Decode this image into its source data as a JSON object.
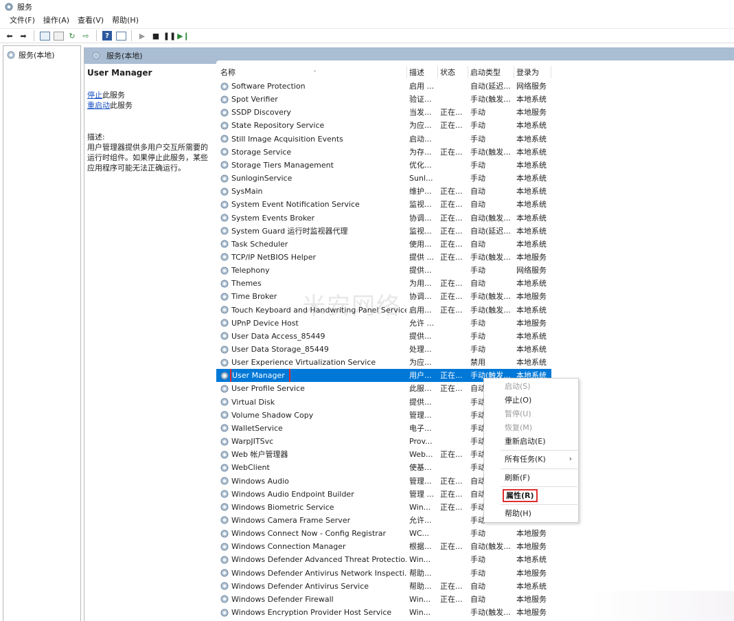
{
  "window": {
    "title": "服务"
  },
  "menubar": {
    "items": [
      "文件(F)",
      "操作(A)",
      "查看(V)",
      "帮助(H)"
    ]
  },
  "navpane": {
    "root_label": "服务(本地)"
  },
  "content": {
    "header_label": "服务(本地)",
    "selected_service_title": "User Manager",
    "stop_link": "停止",
    "stop_suffix": "此服务",
    "restart_link": "重启动",
    "restart_suffix": "此服务",
    "desc_label": "描述:",
    "desc_text": "用户管理器提供多用户交互所需要的运行时组件。如果停止此服务，某些应用程序可能无法正确运行。"
  },
  "table": {
    "headers": {
      "name": "名称",
      "desc": "描述",
      "status": "状态",
      "start": "启动类型",
      "logon": "登录为"
    },
    "rows": [
      {
        "name": "Software Protection",
        "desc": "启用 ...",
        "status": "",
        "start": "自动(延迟...",
        "logon": "网络服务"
      },
      {
        "name": "Spot Verifier",
        "desc": "验证...",
        "status": "",
        "start": "手动(触发...",
        "logon": "本地系统"
      },
      {
        "name": "SSDP Discovery",
        "desc": "当发...",
        "status": "正在...",
        "start": "手动",
        "logon": "本地服务"
      },
      {
        "name": "State Repository Service",
        "desc": "为应...",
        "status": "正在...",
        "start": "手动",
        "logon": "本地系统"
      },
      {
        "name": "Still Image Acquisition Events",
        "desc": "启动...",
        "status": "",
        "start": "手动",
        "logon": "本地系统"
      },
      {
        "name": "Storage Service",
        "desc": "为存...",
        "status": "正在...",
        "start": "手动(触发...",
        "logon": "本地系统"
      },
      {
        "name": "Storage Tiers Management",
        "desc": "优化...",
        "status": "",
        "start": "手动",
        "logon": "本地系统"
      },
      {
        "name": "SunloginService",
        "desc": "Sunl...",
        "status": "",
        "start": "手动",
        "logon": "本地系统"
      },
      {
        "name": "SysMain",
        "desc": "维护...",
        "status": "正在...",
        "start": "自动",
        "logon": "本地系统"
      },
      {
        "name": "System Event Notification Service",
        "desc": "监视...",
        "status": "正在...",
        "start": "自动",
        "logon": "本地系统"
      },
      {
        "name": "System Events Broker",
        "desc": "协调...",
        "status": "正在...",
        "start": "自动(触发...",
        "logon": "本地系统"
      },
      {
        "name": "System Guard 运行时监视器代理",
        "desc": "监视...",
        "status": "正在...",
        "start": "自动(延迟...",
        "logon": "本地系统"
      },
      {
        "name": "Task Scheduler",
        "desc": "使用...",
        "status": "正在...",
        "start": "自动",
        "logon": "本地系统"
      },
      {
        "name": "TCP/IP NetBIOS Helper",
        "desc": "提供 ...",
        "status": "正在...",
        "start": "手动(触发...",
        "logon": "本地服务"
      },
      {
        "name": "Telephony",
        "desc": "提供...",
        "status": "",
        "start": "手动",
        "logon": "网络服务"
      },
      {
        "name": "Themes",
        "desc": "为用...",
        "status": "正在...",
        "start": "自动",
        "logon": "本地系统"
      },
      {
        "name": "Time Broker",
        "desc": "协调...",
        "status": "正在...",
        "start": "手动(触发...",
        "logon": "本地服务"
      },
      {
        "name": "Touch Keyboard and Handwriting Panel Service",
        "desc": "启用...",
        "status": "正在...",
        "start": "手动(触发...",
        "logon": "本地系统"
      },
      {
        "name": "UPnP Device Host",
        "desc": "允许 ...",
        "status": "",
        "start": "手动",
        "logon": "本地服务"
      },
      {
        "name": "User Data Access_85449",
        "desc": "提供...",
        "status": "",
        "start": "手动",
        "logon": "本地系统"
      },
      {
        "name": "User Data Storage_85449",
        "desc": "处理...",
        "status": "",
        "start": "手动",
        "logon": "本地系统"
      },
      {
        "name": "User Experience Virtualization Service",
        "desc": "为应...",
        "status": "",
        "start": "禁用",
        "logon": "本地系统"
      },
      {
        "name": "User Manager",
        "desc": "用户...",
        "status": "正在...",
        "start": "手动(触发...",
        "logon": "本地系统",
        "selected": true
      },
      {
        "name": "User Profile Service",
        "desc": "此服...",
        "status": "正在...",
        "start": "自动",
        "logon": ""
      },
      {
        "name": "Virtual Disk",
        "desc": "提供...",
        "status": "",
        "start": "手动",
        "logon": ""
      },
      {
        "name": "Volume Shadow Copy",
        "desc": "管理...",
        "status": "",
        "start": "手动",
        "logon": ""
      },
      {
        "name": "WalletService",
        "desc": "电子...",
        "status": "",
        "start": "手动",
        "logon": ""
      },
      {
        "name": "WarpJITSvc",
        "desc": "Prov...",
        "status": "",
        "start": "手动",
        "logon": ""
      },
      {
        "name": "Web 帐户管理器",
        "desc": "Web...",
        "status": "正在...",
        "start": "手动",
        "logon": ""
      },
      {
        "name": "WebClient",
        "desc": "使基...",
        "status": "",
        "start": "手动",
        "logon": ""
      },
      {
        "name": "Windows Audio",
        "desc": "管理...",
        "status": "正在...",
        "start": "自动",
        "logon": ""
      },
      {
        "name": "Windows Audio Endpoint Builder",
        "desc": "管理 ...",
        "status": "正在...",
        "start": "自动",
        "logon": ""
      },
      {
        "name": "Windows Biometric Service",
        "desc": "Win...",
        "status": "正在...",
        "start": "手动",
        "logon": ""
      },
      {
        "name": "Windows Camera Frame Server",
        "desc": "允许...",
        "status": "",
        "start": "手动",
        "logon": ""
      },
      {
        "name": "Windows Connect Now - Config Registrar",
        "desc": "WC...",
        "status": "",
        "start": "手动",
        "logon": "本地服务"
      },
      {
        "name": "Windows Connection Manager",
        "desc": "根据...",
        "status": "正在...",
        "start": "自动(触发...",
        "logon": "本地服务"
      },
      {
        "name": "Windows Defender Advanced Threat Protectio...",
        "desc": "Win...",
        "status": "",
        "start": "手动",
        "logon": "本地系统"
      },
      {
        "name": "Windows Defender Antivirus Network Inspecti...",
        "desc": "帮助...",
        "status": "",
        "start": "手动",
        "logon": "本地服务"
      },
      {
        "name": "Windows Defender Antivirus Service",
        "desc": "帮助...",
        "status": "正在...",
        "start": "自动",
        "logon": "本地系统"
      },
      {
        "name": "Windows Defender Firewall",
        "desc": "Win...",
        "status": "正在...",
        "start": "自动",
        "logon": "本地服务"
      },
      {
        "name": "Windows Encryption Provider Host Service",
        "desc": "Win...",
        "status": "",
        "start": "手动(触发...",
        "logon": "本地服务"
      }
    ]
  },
  "context_menu": {
    "start": "启动(S)",
    "stop": "停止(O)",
    "pause": "暂停(U)",
    "resume": "恢复(M)",
    "restart": "重新启动(E)",
    "all_tasks": "所有任务(K)",
    "refresh": "刷新(F)",
    "properties": "属性(R)",
    "help": "帮助(H)"
  },
  "watermark": {
    "text": "米安网络"
  },
  "colors": {
    "selection": "#0078d7",
    "header_bar": "#a9bdd3",
    "highlight_box": "#e02d2d",
    "link": "#1a53c3"
  }
}
